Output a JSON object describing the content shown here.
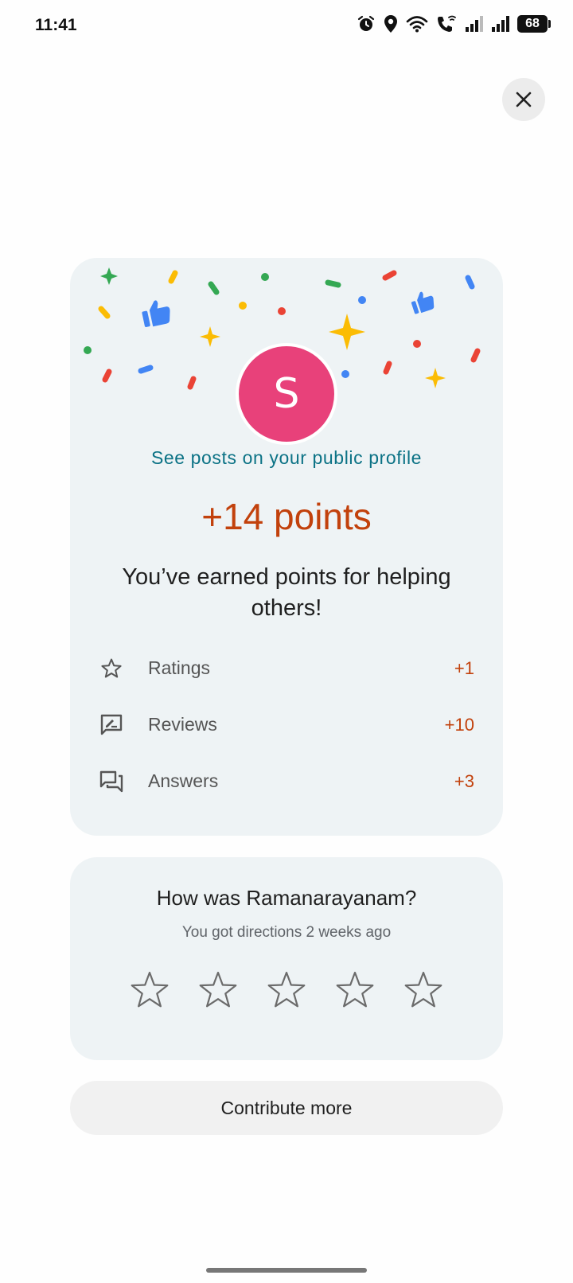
{
  "status_bar": {
    "time": "11:41",
    "battery": "68",
    "icons": [
      "alarm-icon",
      "location-icon",
      "wifi-icon",
      "wifi-calling-icon",
      "signal-icon",
      "signal-icon",
      "battery-icon"
    ]
  },
  "close_icon": "close-icon",
  "profile": {
    "avatar_letter": "S",
    "avatar_color": "#e8417a",
    "link_text": "See posts on your public profile"
  },
  "points": {
    "total": "+14 points",
    "message": "You’ve earned points for helping others!",
    "items": [
      {
        "icon": "star-outline-icon",
        "label": "Ratings",
        "value": "+1"
      },
      {
        "icon": "review-icon",
        "label": "Reviews",
        "value": "+10"
      },
      {
        "icon": "answers-icon",
        "label": "Answers",
        "value": "+3"
      }
    ]
  },
  "rating_prompt": {
    "title": "How was Ramanarayanam?",
    "subtitle": "You got directions 2 weeks ago",
    "star_count": 5
  },
  "contribute_button": "Contribute more",
  "colors": {
    "accent_points": "#c2410c",
    "link": "#0b7285",
    "card_bg": "#eef3f5"
  }
}
